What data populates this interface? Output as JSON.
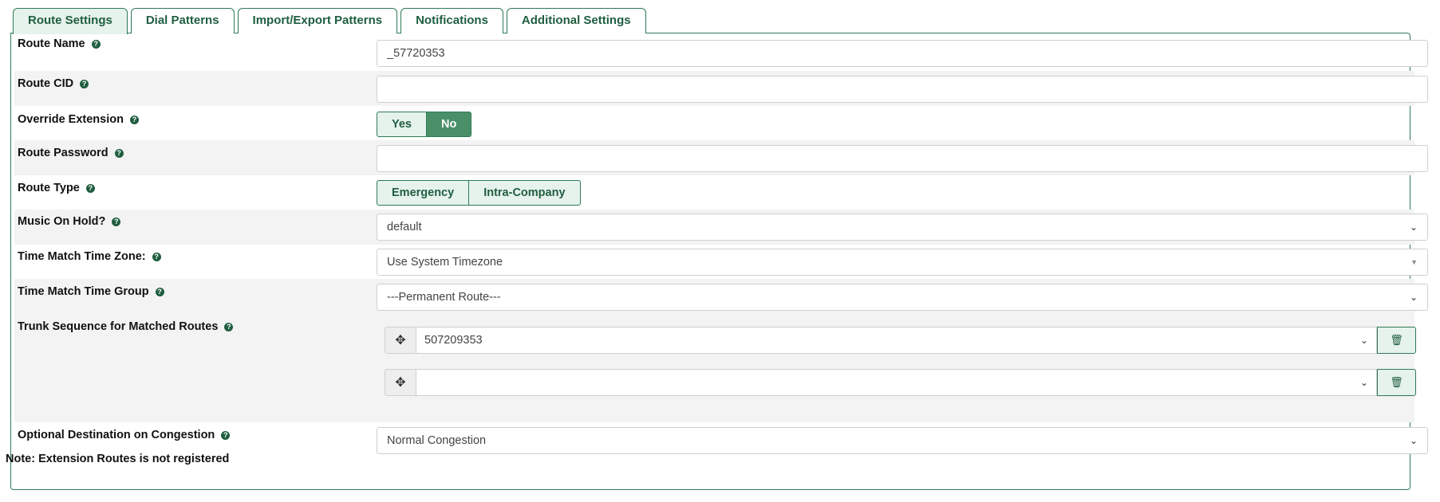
{
  "tabs": [
    {
      "label": "Route Settings"
    },
    {
      "label": "Dial Patterns"
    },
    {
      "label": "Import/Export Patterns"
    },
    {
      "label": "Notifications"
    },
    {
      "label": "Additional Settings"
    }
  ],
  "form": {
    "route_name": {
      "label": "Route Name",
      "value": "_57720353"
    },
    "route_cid": {
      "label": "Route CID",
      "value": ""
    },
    "override_extension": {
      "label": "Override Extension",
      "options": [
        "Yes",
        "No"
      ],
      "selected": "No"
    },
    "route_password": {
      "label": "Route Password",
      "value": ""
    },
    "route_type": {
      "label": "Route Type",
      "options": [
        "Emergency",
        "Intra-Company"
      ]
    },
    "music_on_hold": {
      "label": "Music On Hold?",
      "value": "default"
    },
    "time_zone": {
      "label": "Time Match Time Zone:",
      "value": "Use System Timezone"
    },
    "time_group": {
      "label": "Time Match Time Group",
      "value": "---Permanent Route---"
    },
    "trunk_sequence": {
      "label": "Trunk Sequence for Matched Routes",
      "trunks": [
        "507209353",
        ""
      ]
    },
    "congestion": {
      "label": "Optional Destination on Congestion",
      "value": "Normal Congestion"
    }
  },
  "note": "Note: Extension Routes is not registered",
  "icons": {
    "help": "question-circle-icon",
    "drag": "move-arrows-icon",
    "delete": "trash-icon"
  },
  "colors": {
    "accent": "#2f7a56",
    "accent_light": "#e6f2ec",
    "selected": "#4a8f68"
  }
}
